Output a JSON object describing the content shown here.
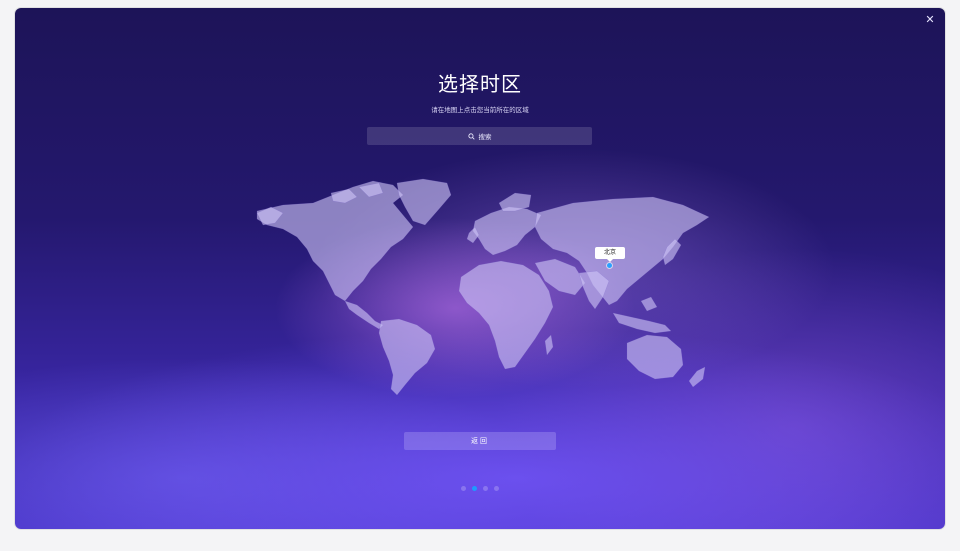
{
  "window": {
    "close_glyph": "✕"
  },
  "header": {
    "title": "选择时区",
    "subtitle": "请在地图上点击您当前所在的区域"
  },
  "search": {
    "icon": "search-icon",
    "label": "搜索"
  },
  "map": {
    "selected_city": "北京",
    "marker_color": "#2aa0ff"
  },
  "footer": {
    "back_label": "返回"
  },
  "pagination": {
    "total": 4,
    "active_index": 1,
    "active_color": "#1d9bff"
  }
}
